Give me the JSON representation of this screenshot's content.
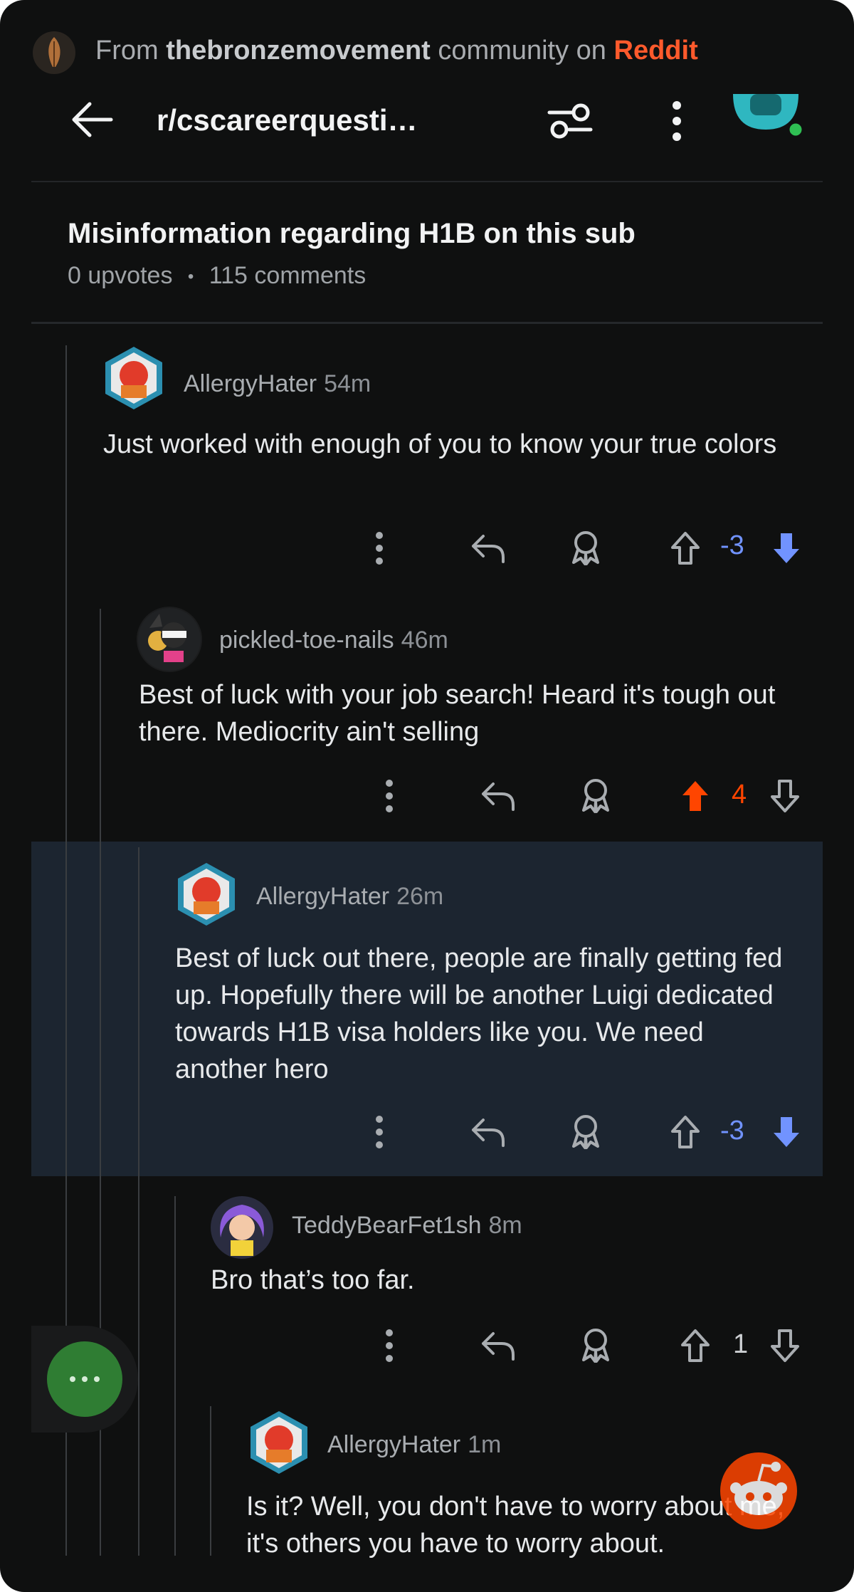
{
  "banner": {
    "prefix": "From",
    "community": "thebronzemovement",
    "middle": "community on",
    "platform": "Reddit"
  },
  "header": {
    "subreddit": "r/cscareerquesti…",
    "back_icon": "back-arrow-icon",
    "filter_icon": "sort-filter-icon",
    "more_icon": "more-vertical-icon"
  },
  "post": {
    "title": "Misinformation regarding H1B on this sub",
    "upvotes": "0 upvotes",
    "separator": "•",
    "comments": "115 comments"
  },
  "comments": [
    {
      "user": "AllergyHater",
      "time": "54m",
      "text": "Just worked with enough of you to know your true colors",
      "score": "-3",
      "vote": "down"
    },
    {
      "user": "pickled-toe-nails",
      "time": "46m",
      "text": "Best of luck with your job search! Heard it's tough out there. Mediocrity ain't selling",
      "score": "4",
      "vote": "up"
    },
    {
      "user": "AllergyHater",
      "time": "26m",
      "text": "Best of luck out there, people are finally getting fed up. Hopefully there will be another Luigi dedicated towards H1B visa holders like you. We need another hero",
      "score": "-3",
      "vote": "down"
    },
    {
      "user": "TeddyBearFet1sh",
      "time": "8m",
      "text": "Bro that’s too far.",
      "score": "1",
      "vote": "none"
    },
    {
      "user": "AllergyHater",
      "time": "1m",
      "text": "Is it? Well, you don't have to worry about me, it's others you have to worry about."
    }
  ],
  "colors": {
    "background": "#0f1010",
    "upvote": "#ff4500",
    "downvote": "#7193ff",
    "highlight": "#1c2530"
  }
}
